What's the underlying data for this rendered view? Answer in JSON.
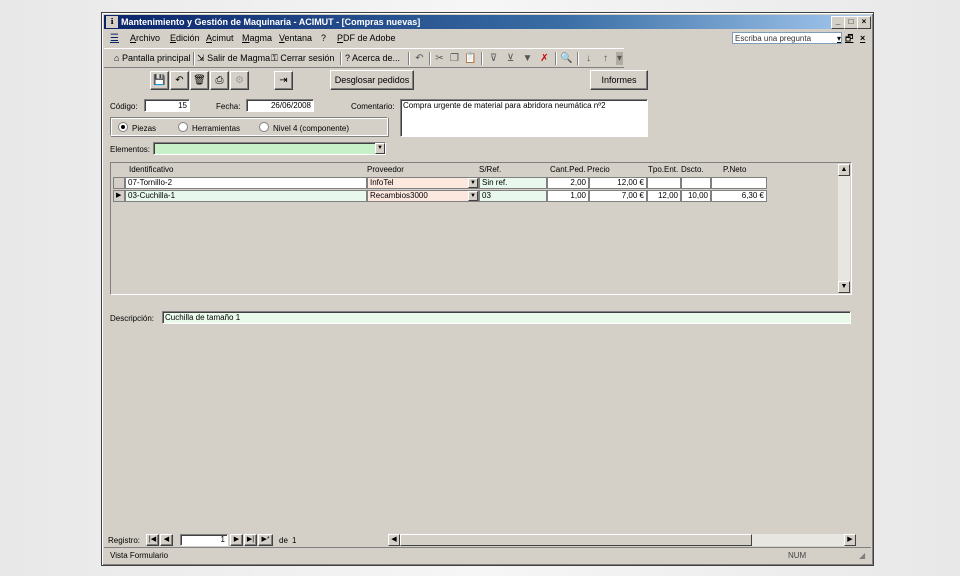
{
  "window": {
    "title": "Mantenimiento y Gestión de Maquinaria - ACIMUT - [Compras nuevas]",
    "app_icon": "access-icon"
  },
  "menu": {
    "items": [
      "Archivo",
      "Edición",
      "Acimut",
      "Magma",
      "Ventana",
      "?",
      "PDF de Adobe"
    ],
    "ask_placeholder": "Escriba una pregunta"
  },
  "toolbar": {
    "pantalla_principal": "Pantalla principal",
    "salir_magma": "Salir de Magma",
    "cerrar_sesion": "Cerrar sesión",
    "acerca_de": "Acerca de..."
  },
  "form": {
    "desglosar_label": "Desglosar pedidos",
    "informes_label": "Informes",
    "codigo_label": "Código:",
    "codigo_value": "15",
    "fecha_label": "Fecha:",
    "fecha_value": "26/06/2008",
    "comentario_label": "Comentario:",
    "comentario_value": "Compra urgente de material para abridora neumática nº2",
    "radios": [
      {
        "label": "Piezas",
        "checked": true
      },
      {
        "label": "Herramientas",
        "checked": false
      },
      {
        "label": "Nivel 4 (componente)",
        "checked": false
      }
    ],
    "elementos_label": "Elementos:",
    "elementos_value": ""
  },
  "grid": {
    "headers": [
      "Identificativo",
      "Proveedor",
      "S/Ref.",
      "Cant.Ped.",
      "Precio",
      "Tpo.Ent.",
      "Dscto.",
      "P.Neto"
    ],
    "rows": [
      {
        "id": "07-Tornillo-2",
        "proveedor": "InfoTel",
        "sref": "Sin ref.",
        "cant": "2,00",
        "precio": "12,00 €",
        "tpo": "",
        "dscto": "",
        "pneto": ""
      },
      {
        "id": "03-Cuchilla-1",
        "proveedor": "Recambios3000",
        "sref": "03",
        "cant": "1,00",
        "precio": "7,00 €",
        "tpo": "12,00",
        "dscto": "10,00",
        "pneto": "6,30 €"
      }
    ]
  },
  "descripcion": {
    "label": "Descripción:",
    "value": "Cuchilla de tamaño 1"
  },
  "navigation": {
    "registro_label": "Registro:",
    "current": "1",
    "of_label": "de",
    "total": "1"
  },
  "status": {
    "view": "Vista Formulario",
    "num": "NUM"
  }
}
